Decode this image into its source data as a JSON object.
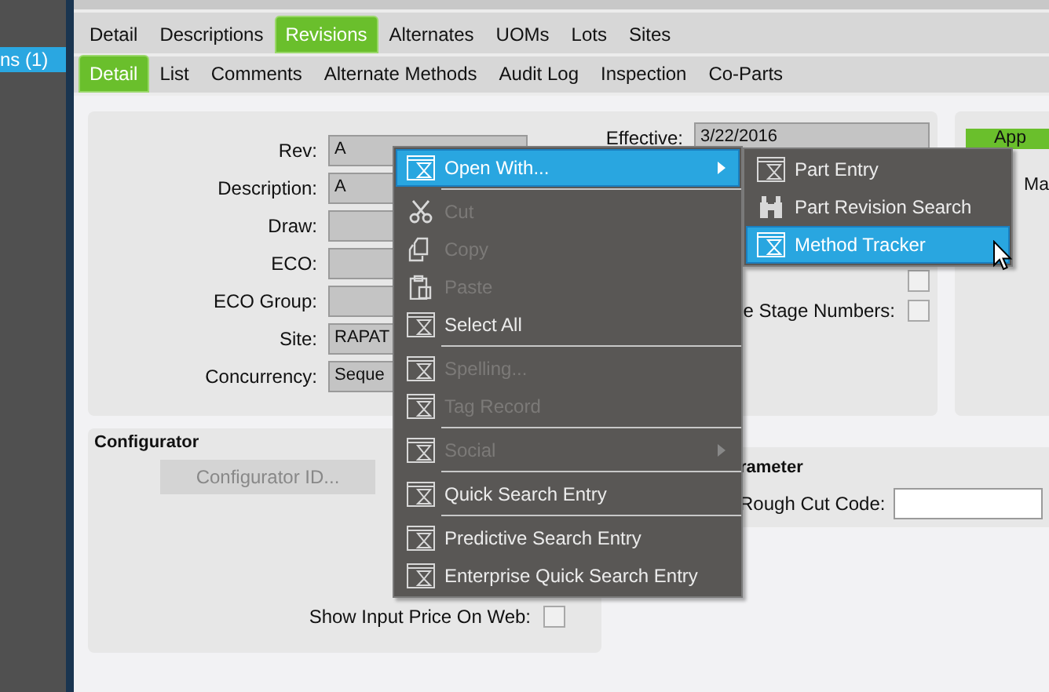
{
  "sidebar": {
    "items": [
      {
        "label": "ns (1)",
        "selected": true
      }
    ]
  },
  "tabs": [
    {
      "label": "Detail",
      "selected": false
    },
    {
      "label": "Descriptions",
      "selected": false
    },
    {
      "label": "Revisions",
      "selected": true
    },
    {
      "label": "Alternates",
      "selected": false
    },
    {
      "label": "UOMs",
      "selected": false
    },
    {
      "label": "Lots",
      "selected": false
    },
    {
      "label": "Sites",
      "selected": false
    }
  ],
  "subtabs": [
    {
      "label": "Detail",
      "selected": true
    },
    {
      "label": "List",
      "selected": false
    },
    {
      "label": "Comments",
      "selected": false
    },
    {
      "label": "Alternate Methods",
      "selected": false
    },
    {
      "label": "Audit Log",
      "selected": false
    },
    {
      "label": "Inspection",
      "selected": false
    },
    {
      "label": "Co-Parts",
      "selected": false
    }
  ],
  "revision_form": {
    "fields": [
      {
        "label": "Rev:",
        "value": "A"
      },
      {
        "label": "Description:",
        "value": "A"
      },
      {
        "label": "Draw:"
      },
      {
        "label": "ECO:"
      },
      {
        "label": "ECO Group:"
      },
      {
        "label": "Site:",
        "value": "RAPAT"
      },
      {
        "label": "Concurrency:",
        "value": "Seque"
      }
    ],
    "effective": {
      "label": "Effective:",
      "value": "3/22/2016"
    },
    "checkboxes": [
      {
        "checked": false
      },
      {
        "label": "e Stage Numbers:",
        "checked": false
      }
    ]
  },
  "side_panel": {
    "button": "App",
    "label": "Ma"
  },
  "configurator": {
    "title": "Configurator",
    "button": "Configurator ID...",
    "checkbox": {
      "label": "Show Input Price On Web:",
      "checked": false
    }
  },
  "parameter": {
    "title": "rameter",
    "field": {
      "label": "Rough Cut Code:"
    }
  },
  "context_menu": {
    "items": [
      {
        "kind": "item",
        "label": "Open With...",
        "disabled": false,
        "selected": true,
        "submenu": true
      },
      {
        "kind": "separator"
      },
      {
        "kind": "item",
        "label": "Cut",
        "disabled": true,
        "selected": false,
        "submenu": false
      },
      {
        "kind": "item",
        "label": "Copy",
        "disabled": true,
        "selected": false,
        "submenu": false
      },
      {
        "kind": "item",
        "label": "Paste",
        "disabled": true,
        "selected": false,
        "submenu": false
      },
      {
        "kind": "item",
        "label": "Select All",
        "disabled": false,
        "selected": false,
        "submenu": false
      },
      {
        "kind": "separator"
      },
      {
        "kind": "item",
        "label": "Spelling...",
        "disabled": true,
        "selected": false,
        "submenu": false
      },
      {
        "kind": "item",
        "label": "Tag Record",
        "disabled": true,
        "selected": false,
        "submenu": false
      },
      {
        "kind": "separator"
      },
      {
        "kind": "item",
        "label": "Social",
        "disabled": true,
        "selected": false,
        "submenu": true
      },
      {
        "kind": "separator"
      },
      {
        "kind": "item",
        "label": "Quick Search Entry",
        "disabled": false,
        "selected": false,
        "submenu": false
      },
      {
        "kind": "separator"
      },
      {
        "kind": "item",
        "label": "Predictive Search Entry",
        "disabled": false,
        "selected": false,
        "submenu": false
      },
      {
        "kind": "item",
        "label": "Enterprise Quick Search Entry",
        "disabled": false,
        "selected": false,
        "submenu": false
      }
    ]
  },
  "submenu": {
    "items": [
      {
        "label": "Part Entry",
        "selected": false
      },
      {
        "label": "Part Revision Search",
        "selected": false
      },
      {
        "label": "Method Tracker",
        "selected": true
      }
    ]
  }
}
